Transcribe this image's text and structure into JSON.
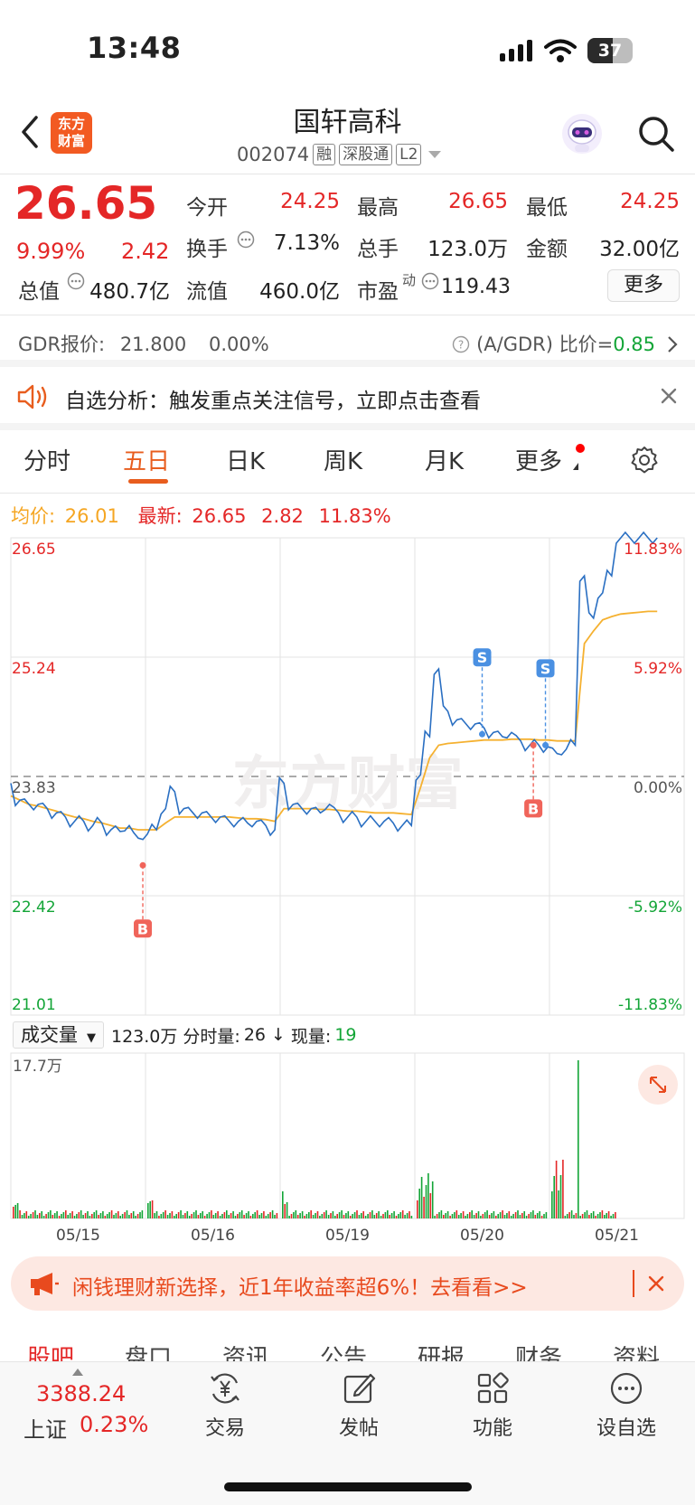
{
  "status_bar": {
    "time": "13:48",
    "battery": "37"
  },
  "header": {
    "logo": "东方\n财富",
    "logo_line1": "东方",
    "logo_line2": "财富",
    "stock_name": "国轩高科",
    "stock_code": "002074",
    "tags": [
      "融",
      "深股通",
      "L2"
    ]
  },
  "quote": {
    "price": "26.65",
    "change_pct": "9.99%",
    "change": "2.42",
    "fields": [
      {
        "label": "今开",
        "value": "24.25",
        "color": "red"
      },
      {
        "label": "最高",
        "value": "26.65",
        "color": "red"
      },
      {
        "label": "最低",
        "value": "24.25",
        "color": "red"
      },
      {
        "label": "换手",
        "value": "7.13%",
        "color": "black"
      },
      {
        "label": "总手",
        "value": "123.0万",
        "color": "black"
      },
      {
        "label": "金额",
        "value": "32.00亿",
        "color": "black"
      },
      {
        "label": "总值",
        "value": "480.7亿",
        "color": "black"
      },
      {
        "label": "流值",
        "value": "460.0亿",
        "color": "black"
      },
      {
        "label": "市盈",
        "value": "119.43",
        "color": "black"
      }
    ],
    "pe_superscript": "动",
    "more_label": "更多"
  },
  "gdr": {
    "label": "GDR报价:",
    "price": "21.800",
    "pct": "0.00%",
    "ratio_label": "(A/GDR) 比价=",
    "ratio": "0.85"
  },
  "alert": {
    "text": "自选分析：触发重点关注信号，立即点击查看"
  },
  "tabs": [
    "分时",
    "五日",
    "日K",
    "周K",
    "月K",
    "更多"
  ],
  "active_tab": "五日",
  "avg_row": {
    "avg_label": "均价:",
    "avg_value": "26.01",
    "latest_label": "最新:",
    "latest_value": "26.65",
    "change": "2.82",
    "pct": "11.83%"
  },
  "chart_data": {
    "type": "line",
    "title": "",
    "dates": [
      "05/15",
      "05/16",
      "05/19",
      "05/20",
      "05/21"
    ],
    "y_ticks": [
      "26.65",
      "25.24",
      "23.83",
      "22.42",
      "21.01"
    ],
    "right_ticks": [
      "11.83%",
      "5.92%",
      "0.00%",
      "-5.92%",
      "-11.83%"
    ],
    "ylim": [
      21.01,
      26.65
    ],
    "prev_close": 23.83,
    "watermark": "东方财富",
    "series": [
      {
        "name": "价格",
        "color": "#2a6fc2",
        "values": [
          23.75,
          23.55,
          23.5,
          23.5,
          23.45,
          23.4,
          23.35,
          23.3,
          23.3,
          23.25,
          23.28,
          23.2,
          23.18,
          23.25,
          23.1,
          23.15,
          23.2,
          23.45,
          23.65,
          23.45,
          23.4,
          23.4,
          23.35,
          23.35,
          23.3,
          23.3,
          23.28,
          23.3,
          23.25,
          23.2,
          23.75,
          23.5,
          23.45,
          23.45,
          23.4,
          23.5,
          23.4,
          23.35,
          23.35,
          23.3,
          23.3,
          23.3,
          23.28,
          23.25,
          23.25,
          23.85,
          24.3,
          25.1,
          24.6,
          24.5,
          24.45,
          24.45,
          24.4,
          24.35,
          24.3,
          24.35,
          24.25,
          24.2,
          24.2,
          24.18,
          24.1,
          24.15,
          24.2,
          26.2,
          25.7,
          26.0,
          26.2,
          26.65,
          26.65,
          26.65,
          26.65,
          26.65
        ]
      },
      {
        "name": "均价",
        "color": "#f5b130",
        "values": [
          23.6,
          23.55,
          23.5,
          23.48,
          23.45,
          23.42,
          23.38,
          23.35,
          23.33,
          23.3,
          23.28,
          23.25,
          23.22,
          23.22,
          23.2,
          23.2,
          23.2,
          23.28,
          23.35,
          23.35,
          23.35,
          23.35,
          23.35,
          23.35,
          23.35,
          23.34,
          23.33,
          23.33,
          23.32,
          23.3,
          23.45,
          23.45,
          23.45,
          23.45,
          23.44,
          23.44,
          23.43,
          23.42,
          23.42,
          23.41,
          23.4,
          23.4,
          23.4,
          23.39,
          23.38,
          23.7,
          24.05,
          24.2,
          24.22,
          24.23,
          24.24,
          24.25,
          24.26,
          24.26,
          24.26,
          24.27,
          24.27,
          24.27,
          24.26,
          24.26,
          24.25,
          24.25,
          24.25,
          25.4,
          25.55,
          25.68,
          25.72,
          25.75,
          25.76,
          25.77,
          25.78,
          25.78
        ]
      }
    ],
    "signals": [
      {
        "type": "B",
        "day": 0.98,
        "price": 22.78
      },
      {
        "type": "S",
        "day": 3.5,
        "price": 24.33
      },
      {
        "type": "B",
        "day": 3.88,
        "price": 24.2
      },
      {
        "type": "S",
        "day": 3.97,
        "price": 24.2
      }
    ],
    "volume": {
      "toolbar_label": "成交量",
      "total": "123.0万",
      "fenshi_label": "分时量:",
      "fenshi_value": "26",
      "arrow": "↓",
      "now_label": "现量:",
      "now_value": "19",
      "max_label": "17.7万",
      "max_value": 177000
    }
  },
  "promo": {
    "text": "闲钱理财新选择，近1年收益率超6%！去看看>>"
  },
  "subtabs": [
    "股吧",
    "盘口",
    "资讯",
    "公告",
    "研报",
    "财务",
    "资料"
  ],
  "bottom": {
    "index_value": "3388.24",
    "index_name": "上证",
    "index_change": "0.23%",
    "items": [
      {
        "label": "交易",
        "icon": "yen-exchange-icon"
      },
      {
        "label": "发帖",
        "icon": "edit-post-icon"
      },
      {
        "label": "功能",
        "icon": "grid-icon"
      },
      {
        "label": "设自选",
        "icon": "more-circle-icon"
      }
    ]
  },
  "colors": {
    "up": "#e42727",
    "down": "#13a537",
    "accent": "#e85d1e",
    "price_line": "#2a6fc2",
    "avg_line": "#f5b130"
  }
}
